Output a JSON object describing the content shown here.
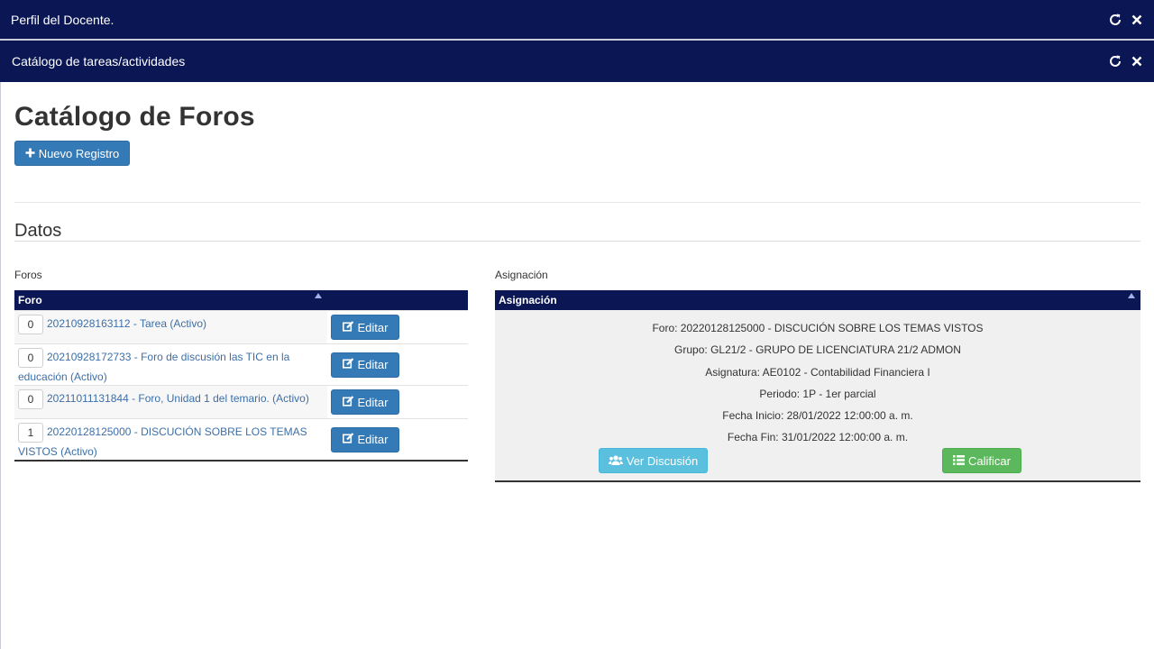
{
  "outer_window": {
    "title": "Perfil del Docente."
  },
  "inner_window": {
    "title": "Catálogo de tareas/actividades"
  },
  "page": {
    "title": "Catálogo de Foros",
    "new_button": "Nuevo Registro",
    "section_title": "Datos"
  },
  "foros_panel": {
    "label": "Foros",
    "column_header": "Foro",
    "rows": [
      {
        "count": "0",
        "text": "20210928163112 - Tarea (Activo)",
        "action": "Editar"
      },
      {
        "count": "0",
        "text": "20210928172733 - Foro de discusión las TIC en la educación (Activo)",
        "action": "Editar"
      },
      {
        "count": "0",
        "text": "20211011131844 - Foro, Unidad 1 del temario. (Activo)",
        "action": "Editar"
      },
      {
        "count": "1",
        "text": "20220128125000 - DISCUCIÓN SOBRE LOS TEMAS VISTOS (Activo)",
        "action": "Editar"
      }
    ]
  },
  "asignacion_panel": {
    "label": "Asignación",
    "column_header": "Asignación",
    "lines": [
      "Foro: 20220128125000 - DISCUCIÓN SOBRE LOS TEMAS VISTOS",
      "Grupo: GL21/2 - GRUPO DE LICENCIATURA 21/2 ADMON",
      "Asignatura: AE0102 - Contabilidad Financiera I",
      "Periodo: 1P - 1er parcial",
      "Fecha Inicio: 28/01/2022 12:00:00 a. m.",
      "Fecha Fin: 31/01/2022 12:00:00 a. m."
    ],
    "ver_button": "Ver Discusión",
    "calificar_button": "Calificar"
  },
  "colors": {
    "header_navy": "#0b1755",
    "primary": "#337ab7",
    "info": "#5bc0de",
    "success": "#5cb85c"
  },
  "icons": {
    "reload": "reload-icon",
    "close": "close-icon",
    "plus": "plus-icon",
    "edit": "edit-icon",
    "users": "users-icon",
    "list": "list-icon"
  }
}
